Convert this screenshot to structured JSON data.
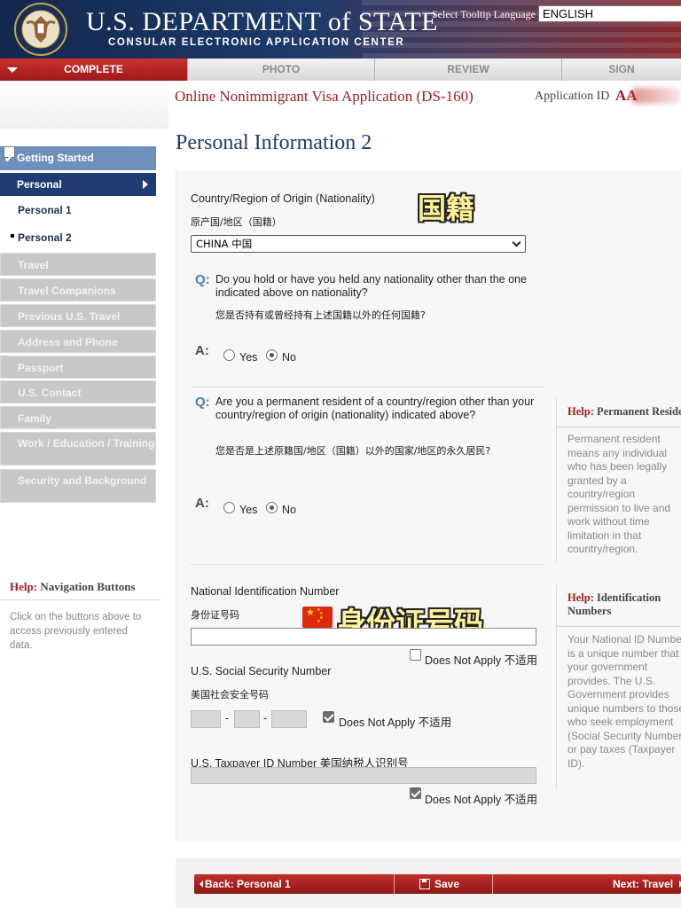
{
  "header": {
    "title": "U.S. DEPARTMENT of STATE",
    "subtitle": "CONSULAR ELECTRONIC APPLICATION CENTER",
    "tooltip_label": "Select Tooltip Language",
    "language": "ENGLISH"
  },
  "progress_tabs": [
    "COMPLETE",
    "PHOTO",
    "REVIEW",
    "SIGN"
  ],
  "app_title": "Online Nonimmigrant Visa Application (DS-160)",
  "application_id": {
    "label": "Application ID",
    "value": "AA"
  },
  "page_title": "Personal Information 2",
  "sidebar": {
    "getting_started": "Getting Started",
    "personal": "Personal",
    "personal1": "Personal 1",
    "personal2": "Personal 2",
    "items": [
      "Travel",
      "Travel Companions",
      "Previous U.S. Travel",
      "Address and Phone",
      "Passport",
      "U.S. Contact",
      "Family",
      "Work / Education / Training",
      "Security and Background"
    ]
  },
  "help_nav": {
    "label": "Help:",
    "title": "Navigation Buttons",
    "body": "Click on the buttons above to access previously entered data."
  },
  "form": {
    "nationality_label": "Country/Region of Origin (Nationality)",
    "nationality_label_zh": "原产国/地区（国籍）",
    "nationality_value": "CHINA 中国",
    "q1": "Do you hold or have you held any nationality other than the one indicated above on nationality?",
    "q1_zh": "您是否持有或曾经持有上述国籍以外的任何国籍?",
    "q2": "Are you a permanent resident of a country/region other than your country/region of origin (nationality) indicated above?",
    "q2_zh": "您是否是上述原籍国/地区（国籍）以外的国家/地区的永久居民?",
    "q_mark": "Q:",
    "a_mark": "A:",
    "yes": "Yes",
    "no": "No",
    "q1_answer": "No",
    "q2_answer": "No",
    "nid_label": "National Identification Number",
    "nid_label_zh": "身份证号码",
    "nid_value": "",
    "ssn_label": "U.S. Social Security Number",
    "ssn_label_zh": "美国社会安全号码",
    "tin_label": "U.S. Taxpayer ID Number 美国纳税人识别号",
    "does_not_apply": "Does Not Apply 不适用",
    "nid_dna_checked": false,
    "ssn_dna_checked": true,
    "tin_dna_checked": true
  },
  "help_permanent": {
    "label": "Help:",
    "title": "Permanent Resident",
    "body": "Permanent resident\nmeans any individual\nwho has been legally\ngranted by a\ncountry/region\npermission to live and\nwork without time\nlimitation in that\ncountry/region."
  },
  "help_id": {
    "label": "Help:",
    "title": "Identification\nNumbers",
    "body": "Your National ID Number\nis a unique number that\nyour government\nprovides. The U.S.\nGovernment provides\nunique numbers to those\nwho seek employment\n(Social Security Number)\nor pay taxes (Taxpayer\nID)."
  },
  "overlays": {
    "nationality": "国籍",
    "id_number": "身份证号码"
  },
  "buttons": {
    "back": "Back: Personal 1",
    "save": "Save",
    "next": "Next: Travel"
  },
  "colors": {
    "header_navy": "#1e3a6b",
    "accent_red": "#9b1c1c",
    "nav_blue": "#1f3d72",
    "question_blue": "#4d7bc0"
  }
}
